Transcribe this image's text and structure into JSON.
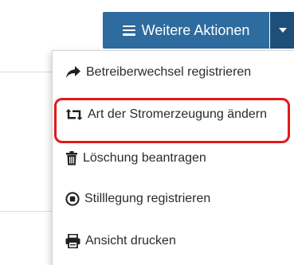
{
  "toolbar": {
    "more_actions_label": "Weitere Aktionen",
    "menu_icon": "list-icon",
    "caret_icon": "caret-down-icon"
  },
  "colors": {
    "primary": "#2e6b9e",
    "primary_dark": "#1d4f7a",
    "highlight": "#e01b1b"
  },
  "dropdown": {
    "items": [
      {
        "label": "Betreiberwechsel registrieren",
        "icon": "share-arrow-icon"
      },
      {
        "label": "Art der Stromerzeugung ändern",
        "icon": "retweet-icon",
        "highlighted": true
      },
      {
        "label": "Löschung beantragen",
        "icon": "trash-icon"
      },
      {
        "label": "Stilllegung registrieren",
        "icon": "stop-circle-icon"
      },
      {
        "label": "Ansicht drucken",
        "icon": "print-icon"
      }
    ]
  }
}
